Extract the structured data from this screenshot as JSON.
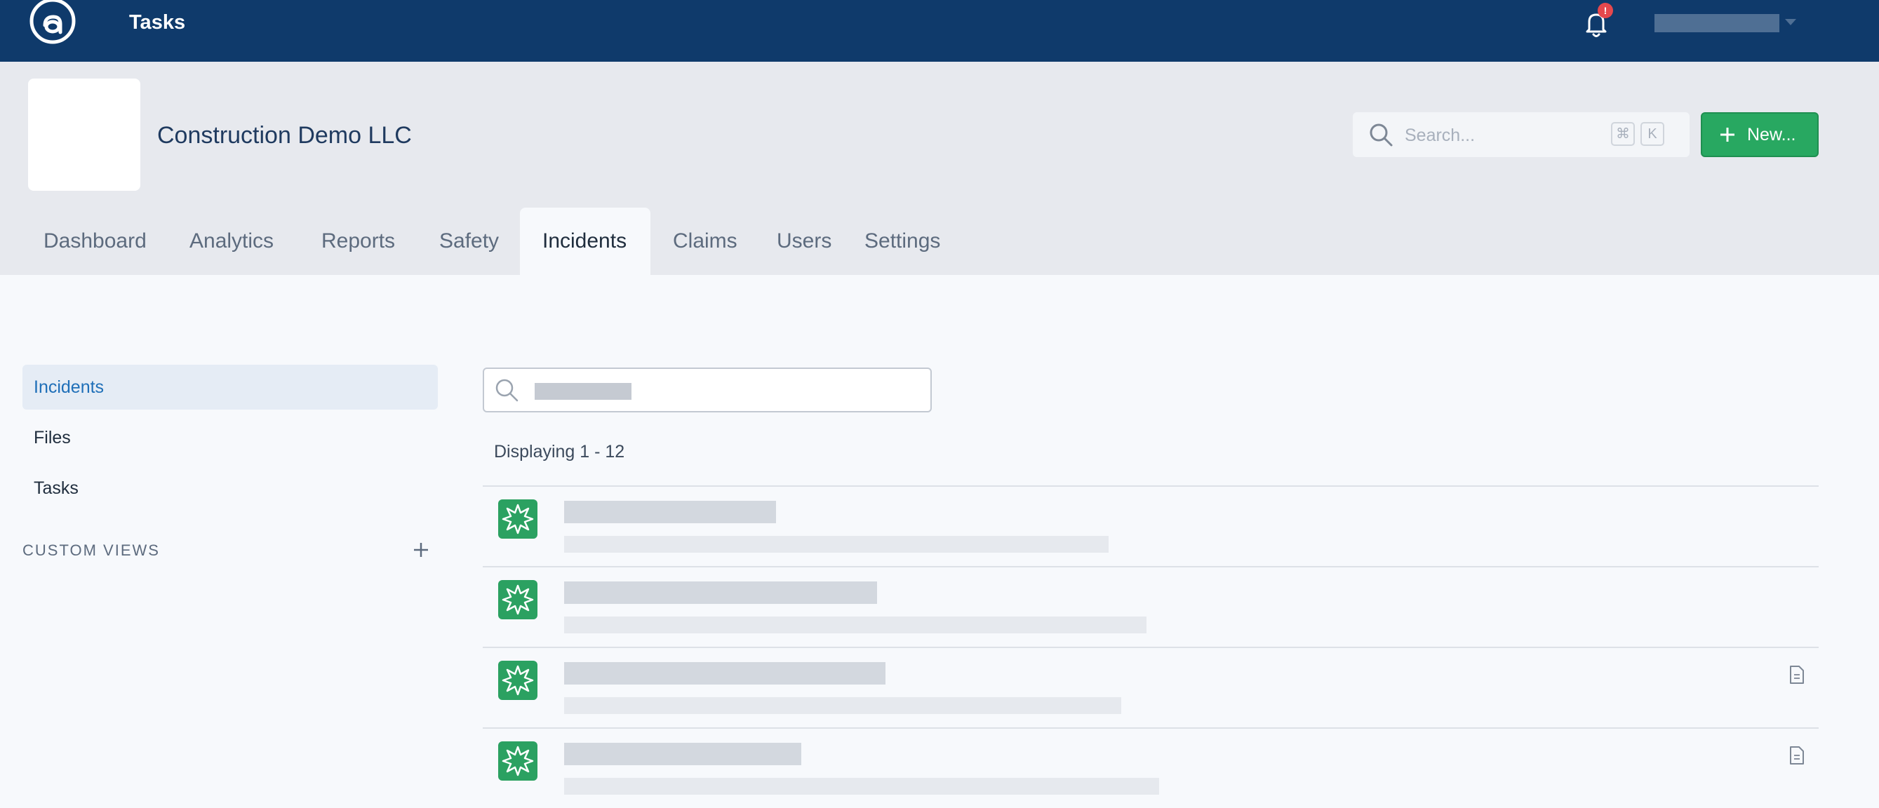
{
  "topbar": {
    "logo_icon": "at-sign-logo-icon",
    "app_title": "Tasks",
    "notifications": {
      "icon": "bell-icon",
      "badge": "!"
    },
    "user_menu_icon": "chevron-down-icon"
  },
  "header": {
    "company_name": "Construction Demo LLC",
    "search": {
      "placeholder": "Search...",
      "shortcut_modifier": "⌘",
      "shortcut_key": "K",
      "icon": "search-icon"
    },
    "new_button": {
      "label": "New...",
      "icon": "plus-icon",
      "color": "#28a861"
    }
  },
  "tabs": [
    {
      "label": "Dashboard",
      "active": false
    },
    {
      "label": "Analytics",
      "active": false
    },
    {
      "label": "Reports",
      "active": false
    },
    {
      "label": "Safety",
      "active": false
    },
    {
      "label": "Incidents",
      "active": true
    },
    {
      "label": "Claims",
      "active": false
    },
    {
      "label": "Users",
      "active": false
    },
    {
      "label": "Settings",
      "active": false
    }
  ],
  "sidebar": {
    "items": [
      {
        "label": "Incidents",
        "active": true
      },
      {
        "label": "Files",
        "active": false
      },
      {
        "label": "Tasks",
        "active": false
      }
    ],
    "custom_views": {
      "label": "CUSTOM VIEWS",
      "add_icon": "plus-icon"
    }
  },
  "main": {
    "search_icon": "search-icon",
    "display_count": "Displaying 1 - 12",
    "rows": [
      {
        "icon": "incident-burst-icon",
        "has_attachment": false
      },
      {
        "icon": "incident-burst-icon",
        "has_attachment": false
      },
      {
        "icon": "incident-burst-icon",
        "has_attachment": true,
        "attachment_icon": "document-icon"
      },
      {
        "icon": "incident-burst-icon",
        "has_attachment": true,
        "attachment_icon": "document-icon"
      }
    ]
  }
}
